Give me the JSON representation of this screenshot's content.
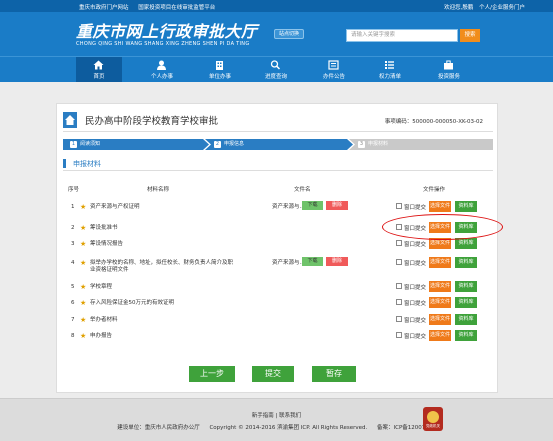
{
  "topbar": {
    "links": [
      "重庆市政府门户网站",
      "国家投资项目在线审批监管平台"
    ],
    "right": [
      "欢迎您,殷鹏",
      "个人/企业服务门户"
    ]
  },
  "header": {
    "logo_cn": "重庆市网上行政审批大厅",
    "logo_en": "CHONG QING SHI WANG SHANG XING ZHENG SHEN PI DA TING",
    "site_switch": "站点切换",
    "search_placeholder": "请输入关键字搜索",
    "search_button": "搜索"
  },
  "nav": [
    {
      "label": "首页",
      "icon": "home-icon",
      "active": true
    },
    {
      "label": "个人办事",
      "icon": "person-icon",
      "active": false
    },
    {
      "label": "单位办事",
      "icon": "building-icon",
      "active": false
    },
    {
      "label": "进度查询",
      "icon": "search-icon",
      "active": false
    },
    {
      "label": "办件公告",
      "icon": "notice-icon",
      "active": false
    },
    {
      "label": "权力清单",
      "icon": "list-icon",
      "active": false
    },
    {
      "label": "投资服务",
      "icon": "briefcase-icon",
      "active": false
    }
  ],
  "page": {
    "title": "民办高中阶段学校教育学校审批",
    "item_code_label": "事项编码：",
    "item_code": "500000-000050-XK-03-02"
  },
  "steps": [
    {
      "num": "1",
      "label": "阅读须知",
      "state": "done"
    },
    {
      "num": "2",
      "label": "申报信息",
      "state": "done"
    },
    {
      "num": "3",
      "label": "申报材料",
      "state": "current"
    }
  ],
  "section_title": "申报材料",
  "table": {
    "headers": {
      "seq": "序号",
      "name": "材料名称",
      "file": "文件名",
      "ops": "文件操作"
    },
    "counter_label": "窗口提交",
    "pick_label": "选择文件",
    "lib_label": "资料库",
    "download_label": "下载",
    "delete_label": "删除",
    "rows": [
      {
        "seq": "1",
        "name": "资产来源与产权证明",
        "file": "资产来源与...",
        "has_file": true
      },
      {
        "seq": "2",
        "name": "筹设批准书",
        "file": "",
        "has_file": false
      },
      {
        "seq": "3",
        "name": "筹设情况报告",
        "file": "",
        "has_file": false
      },
      {
        "seq": "4",
        "name": "拟举办学校的名称、地址，拟任校长、财务负责人简介及职业资格证明文件",
        "file": "资产来源与...",
        "has_file": true
      },
      {
        "seq": "5",
        "name": "学校章程",
        "file": "",
        "has_file": false
      },
      {
        "seq": "6",
        "name": "存入风险保证金50万元的有效证明",
        "file": "",
        "has_file": false
      },
      {
        "seq": "7",
        "name": "举办者材料",
        "file": "",
        "has_file": false
      },
      {
        "seq": "8",
        "name": "申办报告",
        "file": "",
        "has_file": false
      }
    ]
  },
  "buttons": {
    "prev": "上一步",
    "submit": "提交",
    "save": "暂存"
  },
  "footer": {
    "links": [
      "新手指南",
      "联系我们"
    ],
    "copy": [
      "建设单位：重庆市人民政府办公厅",
      "Copyright © 2014-2016 滨渝集团 ICP. All Rights Reserved.",
      "备案：ICP备12007387"
    ],
    "badge_label": "党政机关"
  },
  "colors": {
    "primary": "#1a7cc7",
    "nav_active": "#0d5c9e",
    "orange": "#ef7a1a",
    "green": "#3fa23b",
    "step_current": "#c9c9c9",
    "annotation": "#d11111"
  }
}
